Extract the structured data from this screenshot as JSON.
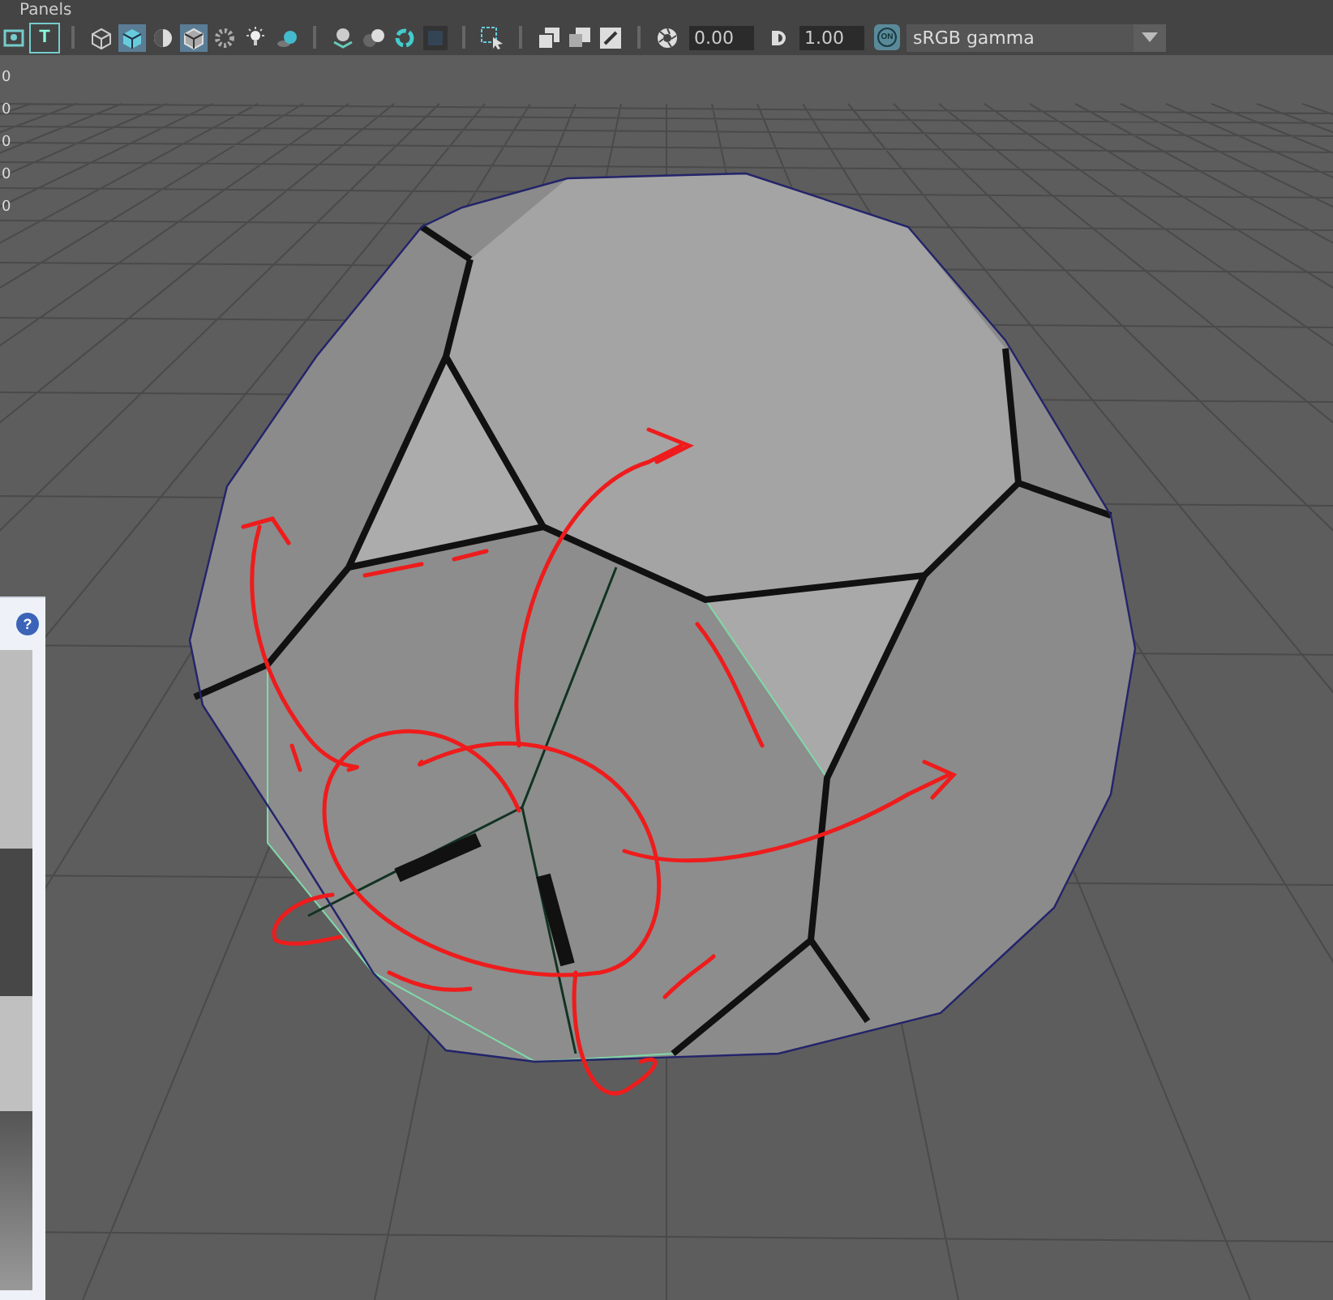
{
  "menu_bar": {
    "label": "Panels"
  },
  "toolbar": {
    "items": [
      {
        "kind": "image",
        "selected": false
      },
      {
        "kind": "text-frame",
        "glyph": "T",
        "selected": false
      },
      {
        "kind": "separator"
      },
      {
        "kind": "wire-cube",
        "selected": false
      },
      {
        "kind": "shaded-cube",
        "selected": true
      },
      {
        "kind": "half-sphere",
        "selected": false
      },
      {
        "kind": "textured-cube",
        "selected": true
      },
      {
        "kind": "checker",
        "selected": false
      },
      {
        "kind": "light",
        "selected": false
      },
      {
        "kind": "ball-shadow",
        "selected": false
      },
      {
        "kind": "separator"
      },
      {
        "kind": "sphere-layers",
        "selected": false
      },
      {
        "kind": "spheres",
        "selected": false
      },
      {
        "kind": "ring",
        "selected": false
      },
      {
        "kind": "square",
        "selected": false
      },
      {
        "kind": "separator"
      },
      {
        "kind": "marquee",
        "selected": false
      },
      {
        "kind": "separator"
      },
      {
        "kind": "overlap",
        "selected": false
      },
      {
        "kind": "overlap-solid",
        "selected": false
      },
      {
        "kind": "picker",
        "selected": false
      },
      {
        "kind": "separator"
      },
      {
        "kind": "aperture",
        "selected": false
      }
    ],
    "exposure": "0.00",
    "gamma_icon": {
      "selected": false
    },
    "gamma": "1.00",
    "color_management": {
      "label": "ON",
      "on": true
    },
    "view_transform": {
      "value": "sRGB gamma"
    }
  },
  "hud_values": [
    "0",
    "0",
    "0",
    "0",
    "0"
  ],
  "side_dialog": {
    "help_button": {
      "glyph": "?"
    }
  }
}
